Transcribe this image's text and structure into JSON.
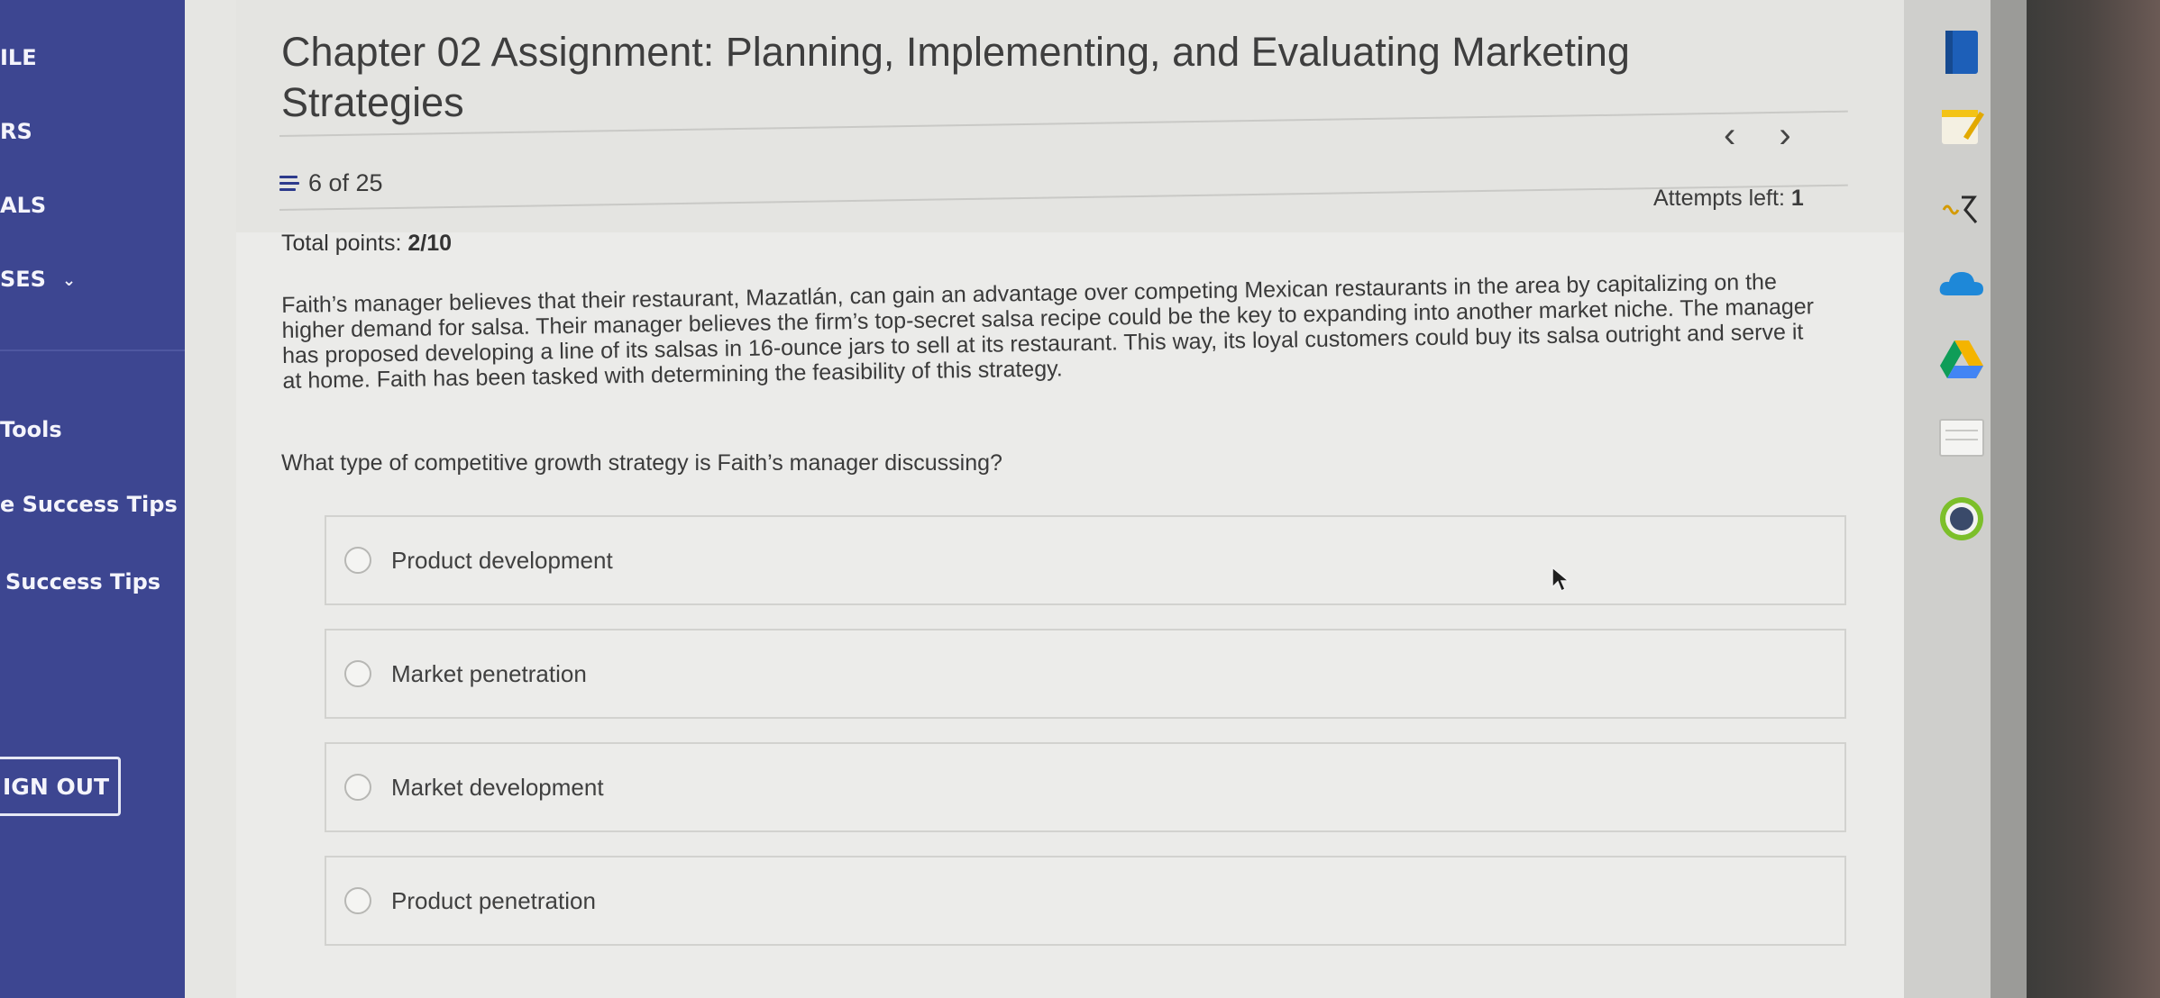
{
  "sidebar": {
    "items": [
      {
        "label": "ILE"
      },
      {
        "label": "RS"
      },
      {
        "label": "ALS"
      },
      {
        "label": "SES"
      },
      {
        "label": "Tools"
      },
      {
        "label": "e Success Tips"
      },
      {
        "label": "Success Tips"
      }
    ],
    "signout_label": "IGN OUT"
  },
  "assignment": {
    "title": "Chapter 02 Assignment: Planning, Implementing, and Evaluating Marketing Strategies",
    "question_position": "6 of 25",
    "attempts_label": "Attempts left:",
    "attempts_value": "1",
    "points_label": "Total points:",
    "points_value": "2/10"
  },
  "question": {
    "text": "Faith’s manager believes that their restaurant, Mazatlán, can gain an advantage over competing Mexican restaurants in the area by capitalizing on the higher demand for salsa. Their manager believes the firm’s top-secret salsa recipe could be the key to expanding into another market niche. The manager has proposed developing a line of its salsas in 16-ounce jars to sell at its restaurant. This way, its loyal customers could buy its salsa outright and serve it at home. Faith has been tasked with determining the feasibility of this strategy.",
    "prompt": "What type of competitive growth strategy is Faith’s manager discussing?",
    "options": [
      {
        "label": "Product development"
      },
      {
        "label": "Market penetration"
      },
      {
        "label": "Market development"
      },
      {
        "label": "Product penetration"
      }
    ]
  },
  "dock": {
    "icons": [
      "book-icon",
      "notepad-pencil-icon",
      "audio-wave-icon",
      "cloud-icon",
      "drive-icon",
      "document-stack-icon",
      "circle-app-icon"
    ]
  }
}
